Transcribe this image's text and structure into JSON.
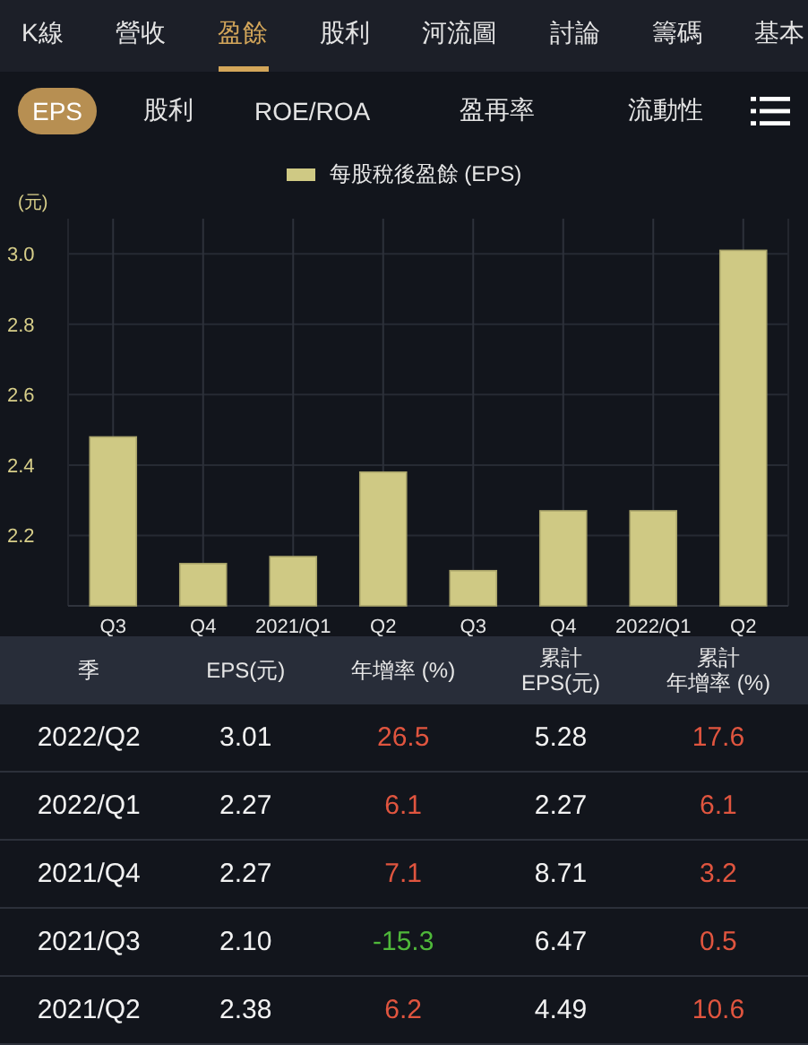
{
  "top_tabs": [
    {
      "label": "K線",
      "selected": false
    },
    {
      "label": "營收",
      "selected": false
    },
    {
      "label": "盈餘",
      "selected": true
    },
    {
      "label": "股利",
      "selected": false
    },
    {
      "label": "河流圖",
      "selected": false
    },
    {
      "label": "討論",
      "selected": false
    },
    {
      "label": "籌碼",
      "selected": false
    },
    {
      "label": "基本",
      "selected": false
    }
  ],
  "sub_tabs": [
    {
      "label": "EPS",
      "selected": true
    },
    {
      "label": "股利",
      "selected": false
    },
    {
      "label": "ROE/ROA",
      "selected": false
    },
    {
      "label": "盈再率",
      "selected": false
    },
    {
      "label": "流動性",
      "selected": false
    }
  ],
  "chart": {
    "unit": "(元)",
    "chart_data": {
      "type": "bar",
      "grid": true,
      "categories": [
        "Q3",
        "Q4",
        "2021/Q1",
        "Q2",
        "Q3",
        "Q4",
        "2022/Q1",
        "Q2"
      ],
      "series": [
        {
          "name": "每股稅後盈餘 (EPS)",
          "color": "#cfc984",
          "values": [
            2.48,
            2.12,
            2.14,
            2.38,
            2.1,
            2.27,
            2.27,
            3.01
          ]
        }
      ],
      "ylim": [
        2.0,
        3.1
      ],
      "yticks": [
        2.2,
        2.4,
        2.6,
        2.8,
        {
          "value": 3.0,
          "label": "3.0"
        }
      ]
    }
  },
  "table": {
    "columns": [
      [
        "季"
      ],
      [
        "EPS(元)"
      ],
      [
        "年增率 (%)"
      ],
      [
        "累計",
        "EPS(元)"
      ],
      [
        "累計",
        "年增率 (%)"
      ]
    ],
    "rows": [
      {
        "quarter": "2022/Q2",
        "eps": "3.01",
        "yoy": {
          "text": "26.5",
          "color": "#e0553f"
        },
        "cum_eps": "5.28",
        "cum_yoy": {
          "text": "17.6",
          "color": "#e0553f"
        }
      },
      {
        "quarter": "2022/Q1",
        "eps": "2.27",
        "yoy": {
          "text": "6.1",
          "color": "#e0553f"
        },
        "cum_eps": "2.27",
        "cum_yoy": {
          "text": "6.1",
          "color": "#e0553f"
        }
      },
      {
        "quarter": "2021/Q4",
        "eps": "2.27",
        "yoy": {
          "text": "7.1",
          "color": "#e0553f"
        },
        "cum_eps": "8.71",
        "cum_yoy": {
          "text": "3.2",
          "color": "#e0553f"
        }
      },
      {
        "quarter": "2021/Q3",
        "eps": "2.10",
        "yoy": {
          "text": "-15.3",
          "color": "#4fb83a"
        },
        "cum_eps": "6.47",
        "cum_yoy": {
          "text": "0.5",
          "color": "#e0553f"
        }
      },
      {
        "quarter": "2021/Q2",
        "eps": "2.38",
        "yoy": {
          "text": "6.2",
          "color": "#e0553f"
        },
        "cum_eps": "4.49",
        "cum_yoy": {
          "text": "10.6",
          "color": "#e0553f"
        }
      }
    ]
  }
}
